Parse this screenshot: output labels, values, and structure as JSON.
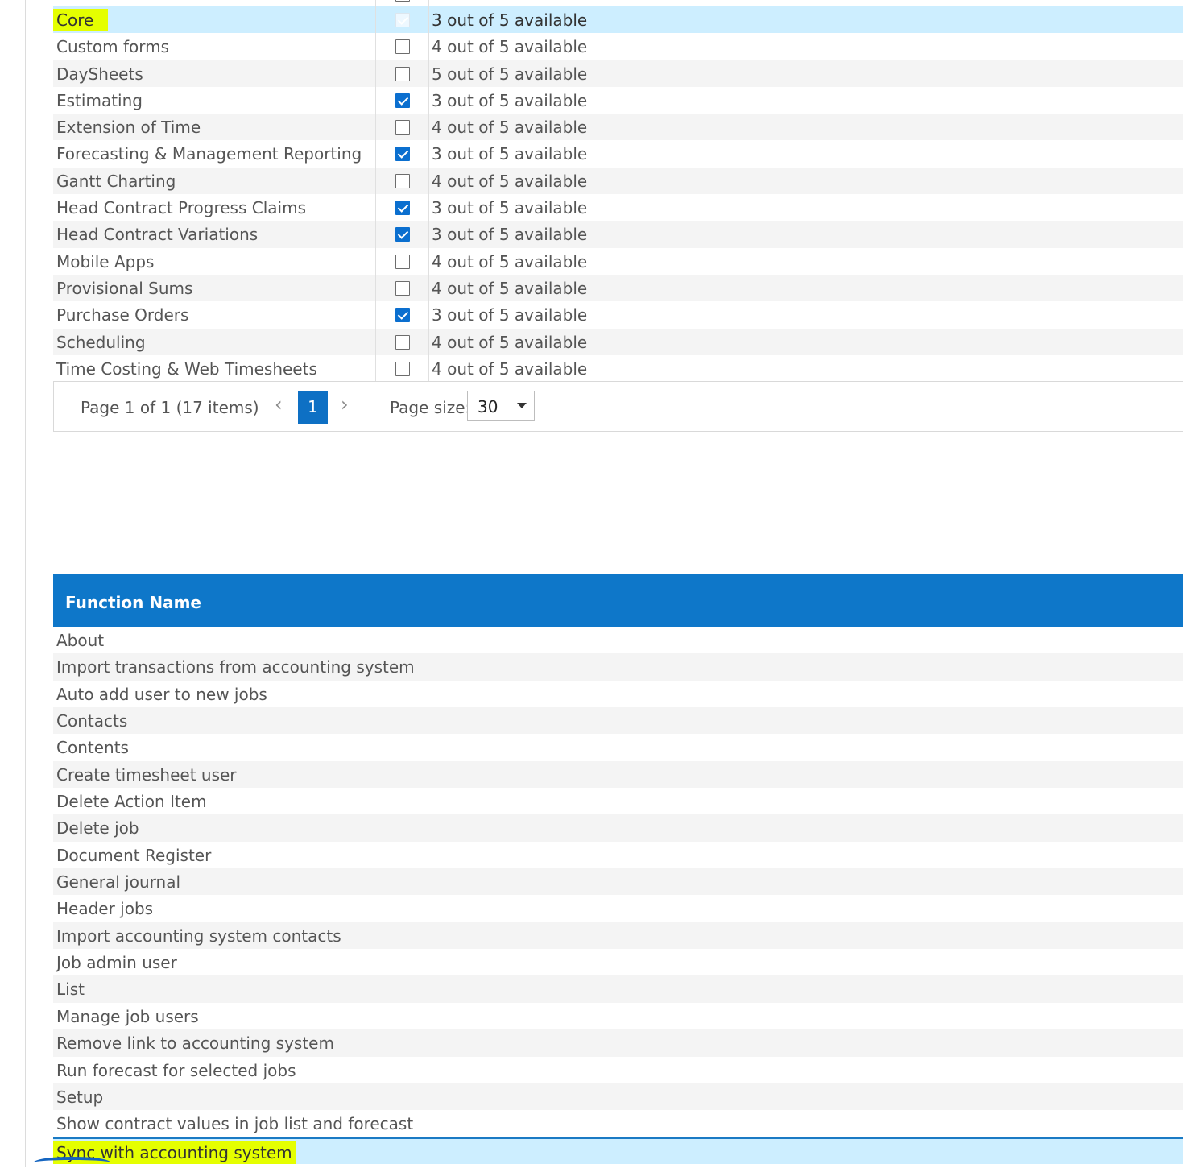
{
  "modules": {
    "rows": [
      {
        "name": "Core",
        "checked": true,
        "available": "3 out of 5 available"
      },
      {
        "name": "Custom forms",
        "checked": false,
        "available": "4 out of 5 available"
      },
      {
        "name": "DaySheets",
        "checked": false,
        "available": "5 out of 5 available"
      },
      {
        "name": "Estimating",
        "checked": true,
        "available": "3 out of 5 available"
      },
      {
        "name": "Extension of Time",
        "checked": false,
        "available": "4 out of 5 available"
      },
      {
        "name": "Forecasting & Management Reporting",
        "checked": true,
        "available": "3 out of 5 available"
      },
      {
        "name": "Gantt Charting",
        "checked": false,
        "available": "4 out of 5 available"
      },
      {
        "name": "Head Contract Progress Claims",
        "checked": true,
        "available": "3 out of 5 available"
      },
      {
        "name": "Head Contract Variations",
        "checked": true,
        "available": "3 out of 5 available"
      },
      {
        "name": "Mobile Apps",
        "checked": false,
        "available": "4 out of 5 available"
      },
      {
        "name": "Provisional Sums",
        "checked": false,
        "available": "4 out of 5 available"
      },
      {
        "name": "Purchase Orders",
        "checked": true,
        "available": "3 out of 5 available"
      },
      {
        "name": "Scheduling",
        "checked": false,
        "available": "4 out of 5 available"
      },
      {
        "name": "Time Costing & Web Timesheets",
        "checked": false,
        "available": "4 out of 5 available"
      }
    ]
  },
  "pager": {
    "summary": "Page 1 of 1 (17 items)",
    "prev_icon": "‹",
    "next_icon": "›",
    "current_page": "1",
    "page_size_label": "Page size:",
    "page_size_value": "30"
  },
  "functions": {
    "header": "Function Name",
    "rows": [
      "About",
      "Import transactions from accounting system",
      "Auto add user to new jobs",
      "Contacts",
      "Contents",
      "Create timesheet user",
      "Delete Action Item",
      "Delete job",
      "Document Register",
      "General journal",
      "Header jobs",
      "Import accounting system contacts",
      "Job admin user",
      "List",
      "Manage job users",
      "Remove link to accounting system",
      "Run forecast for selected jobs",
      "Setup",
      "Show contract values in job list and forecast",
      "Sync with accounting system"
    ]
  },
  "colors": {
    "header_blue": "#0e77c9",
    "selected_row": "#cdeeff",
    "highlight": "#e5ff00",
    "checkbox_checked": "#0b6fcf"
  }
}
